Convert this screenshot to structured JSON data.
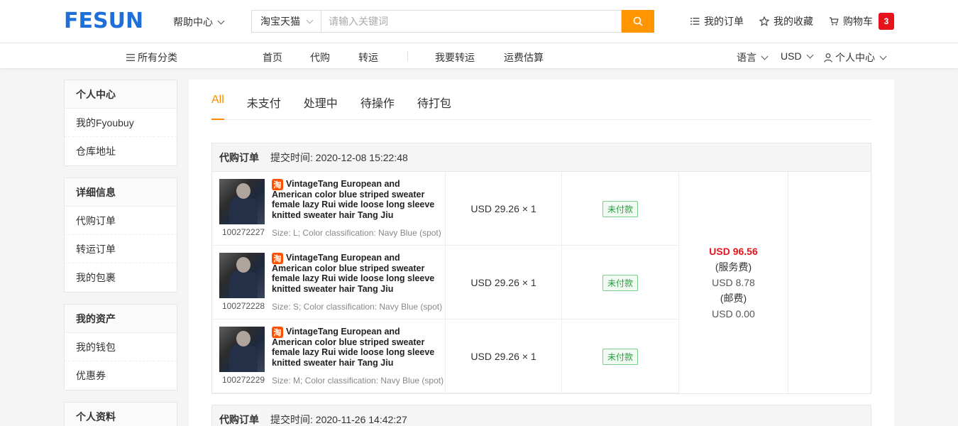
{
  "header": {
    "logo": "FESUN",
    "help": "帮助中心",
    "search": {
      "platform": "淘宝天猫",
      "placeholder": "请输入关键词"
    },
    "links": {
      "orders": "我的订单",
      "favorites": "我的收藏",
      "cart": "购物车",
      "cart_count": "3"
    }
  },
  "nav": {
    "categories": "所有分类",
    "home": "首页",
    "purchase": "代购",
    "forward": "转运",
    "want_forward": "我要转运",
    "shipping_calc": "运费估算",
    "language": "语言",
    "currency": "USD",
    "account": "个人中心"
  },
  "sidebar": {
    "groups": [
      {
        "title": "个人中心",
        "items": [
          "我的Fyoubuy",
          "仓库地址"
        ]
      },
      {
        "title": "详细信息",
        "items": [
          "代购订单",
          "转运订单",
          "我的包裹"
        ]
      },
      {
        "title": "我的资产",
        "items": [
          "我的钱包",
          "优惠券"
        ]
      },
      {
        "title": "个人资料",
        "items": []
      }
    ]
  },
  "tabs": [
    "All",
    "未支付",
    "处理中",
    "待操作",
    "待打包"
  ],
  "orders": [
    {
      "type": "代购订单",
      "time_label": "提交时间:",
      "time": "2020-12-08 15:22:48",
      "items": [
        {
          "id": "100272227",
          "platform_badge": "淘",
          "title": "VintageTang European and American color blue striped sweater female lazy Rui wide loose long sleeve knitted sweater hair Tang Jiu",
          "spec": "Size: L; Color classification: Navy Blue (spot)",
          "price": "USD 29.26 × 1",
          "status": "未付款"
        },
        {
          "id": "100272228",
          "platform_badge": "淘",
          "title": "VintageTang European and American color blue striped sweater female lazy Rui wide loose long sleeve knitted sweater hair Tang Jiu",
          "spec": "Size: S; Color classification: Navy Blue (spot)",
          "price": "USD 29.26 × 1",
          "status": "未付款"
        },
        {
          "id": "100272229",
          "platform_badge": "淘",
          "title": "VintageTang European and American color blue striped sweater female lazy Rui wide loose long sleeve knitted sweater hair Tang Jiu",
          "spec": "Size: M; Color classification: Navy Blue (spot)",
          "price": "USD 29.26 × 1",
          "status": "未付款"
        }
      ],
      "total": "USD 96.56",
      "service_fee_label": "(服务费)",
      "service_fee": "USD 8.78",
      "postage_label": "(邮费)",
      "postage": "USD 0.00"
    },
    {
      "type": "代购订单",
      "time_label": "提交时间:",
      "time": "2020-11-26 14:42:27"
    }
  ],
  "colors": {
    "brand": "#1f6fd9",
    "accent": "#ff9500",
    "price_red": "#e5141c",
    "status_green": "#2aa040"
  }
}
